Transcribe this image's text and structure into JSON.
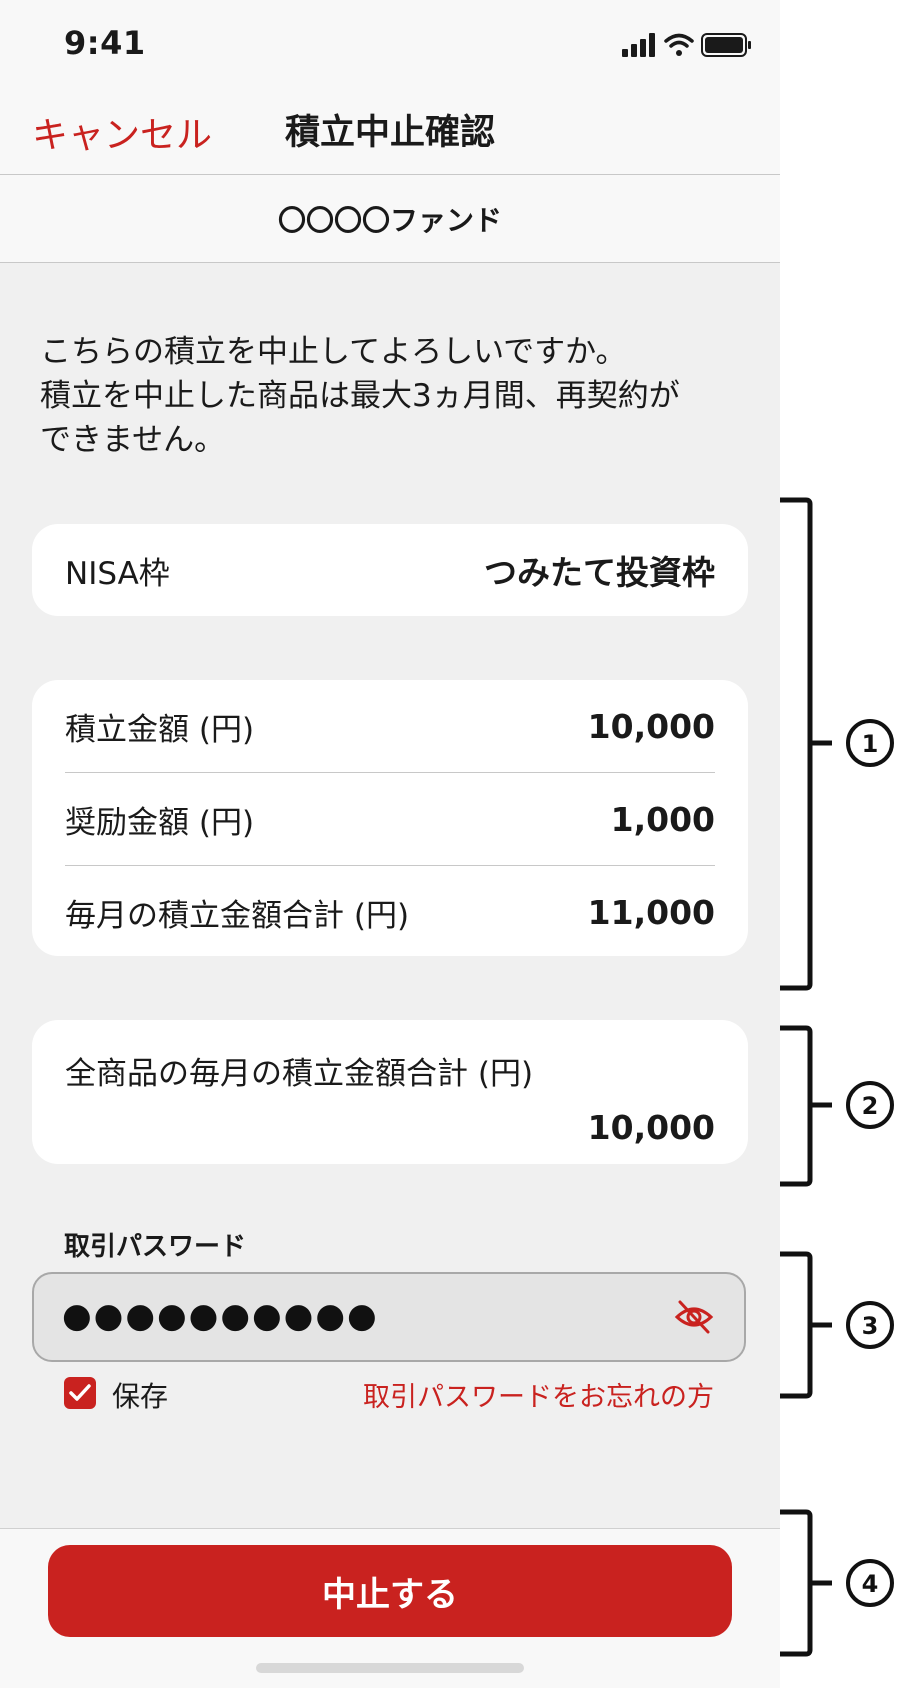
{
  "status_bar": {
    "time": "9:41"
  },
  "nav": {
    "cancel_label": "キャンセル",
    "title": "積立中止確認"
  },
  "fund": {
    "name": "〇〇〇〇ファンド"
  },
  "message": {
    "line1": "こちらの積立を中止してよろしいですか。",
    "line2": "積立を中止した商品は最大3ヵ月間、再契約が",
    "line3": "できません。"
  },
  "nisa": {
    "label": "NISA枠",
    "value": "つみたて投資枠"
  },
  "amounts": {
    "rows": [
      {
        "label": "積立金額 (円)",
        "value": "10,000"
      },
      {
        "label": "奨励金額 (円)",
        "value": "1,000"
      },
      {
        "label": "毎月の積立金額合計 (円)",
        "value": "11,000"
      }
    ]
  },
  "all_total": {
    "label": "全商品の毎月の積立金額合計 (円)",
    "value": "10,000"
  },
  "password": {
    "label": "取引パスワード",
    "value": "●●●●●●●●●●"
  },
  "save": {
    "label": "保存",
    "checked": true
  },
  "forgot_link": "取引パスワードをお忘れの方",
  "submit": {
    "label": "中止する"
  },
  "annotations": [
    "1",
    "2",
    "3",
    "4"
  ],
  "colors": {
    "accent": "#c9221f",
    "background": "#f0f0f0",
    "card": "#ffffff"
  },
  "icons": [
    "signal-icon",
    "wifi-icon",
    "battery-icon",
    "eye-off-icon",
    "checkmark-icon"
  ]
}
